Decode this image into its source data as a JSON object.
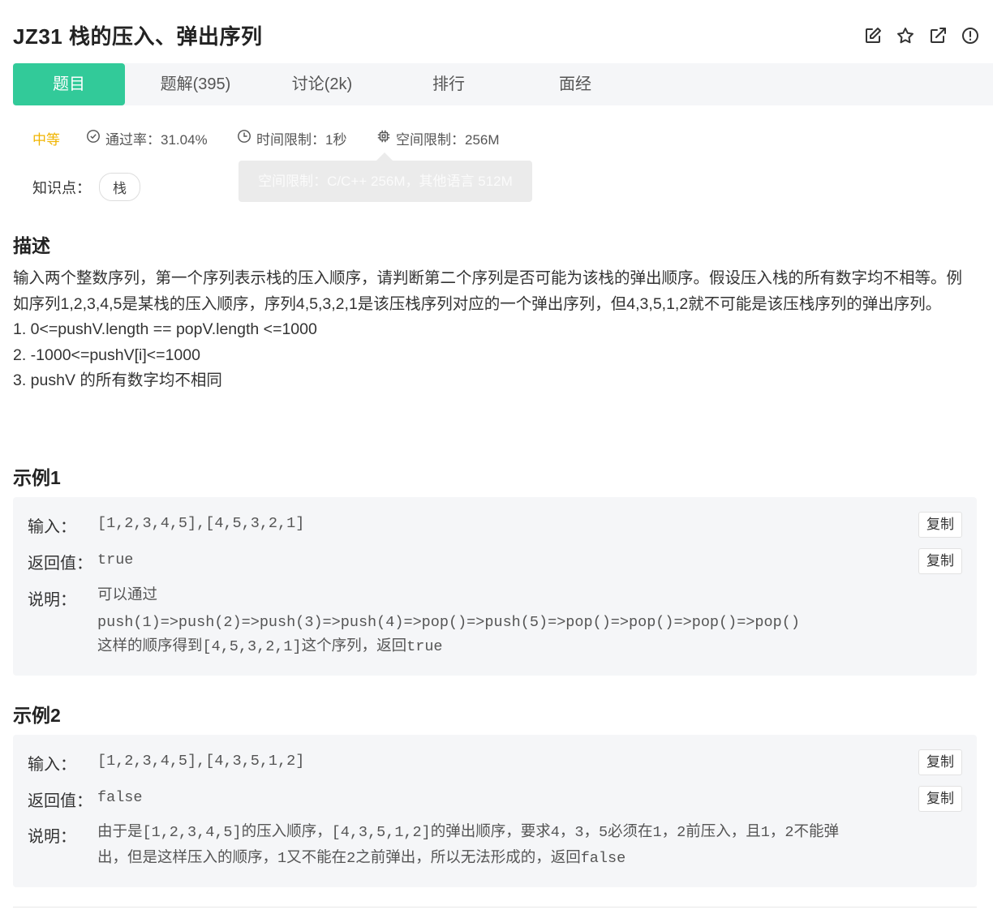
{
  "problem": {
    "title": "JZ31  栈的压入、弹出序列"
  },
  "header_icons": [
    "edit-icon",
    "star-icon",
    "external-link-icon",
    "report-icon"
  ],
  "tabs": [
    {
      "label": "题目",
      "active": true
    },
    {
      "label": "题解(395)"
    },
    {
      "label": "讨论(2k)"
    },
    {
      "label": "排行"
    },
    {
      "label": "面经"
    }
  ],
  "meta": {
    "difficulty": "中等",
    "pass_rate": "通过率：31.04%",
    "time_limit": "时间限制：1秒",
    "space_limit": "空间限制：256M"
  },
  "tooltip": "空间限制：C/C++ 256M，其他语言 512M",
  "knowledge": {
    "label": "知识点：",
    "tag": "栈"
  },
  "description": {
    "heading": "描述",
    "paragraph": "输入两个整数序列，第一个序列表示栈的压入顺序，请判断第二个序列是否可能为该栈的弹出顺序。假设压入栈的所有数字均不相等。例如序列1,2,3,4,5是某栈的压入顺序，序列4,5,3,2,1是该压栈序列对应的一个弹出序列，但4,3,5,1,2就不可能是该压栈序列的弹出序列。",
    "items": [
      "1. 0<=pushV.length == popV.length <=1000",
      "2. -1000<=pushV[i]<=1000",
      "3. pushV 的所有数字均不相同"
    ]
  },
  "examples": [
    {
      "heading": "示例1",
      "input_label": "输入：",
      "input": "[1,2,3,4,5],[4,5,3,2,1]",
      "output_label": "返回值：",
      "output": "true",
      "explain_label": "说明：",
      "explain_lines": [
        "可以通过",
        "push(1)=>push(2)=>push(3)=>push(4)=>pop()=>push(5)=>pop()=>pop()=>pop()=>pop()",
        "这样的顺序得到[4,5,3,2,1]这个序列，返回true"
      ],
      "copy_label": "复制"
    },
    {
      "heading": "示例2",
      "input_label": "输入：",
      "input": "[1,2,3,4,5],[4,3,5,1,2]",
      "output_label": "返回值：",
      "output": "false",
      "explain_label": "说明：",
      "explain_lines": [
        "由于是[1,2,3,4,5]的压入顺序，[4,3,5,1,2]的弹出顺序，要求4，3，5必须在1，2前压入，且1，2不能弹",
        "出，但是这样压入的顺序，1又不能在2之前弹出，所以无法形成的，返回false"
      ],
      "copy_label": "复制"
    }
  ]
}
